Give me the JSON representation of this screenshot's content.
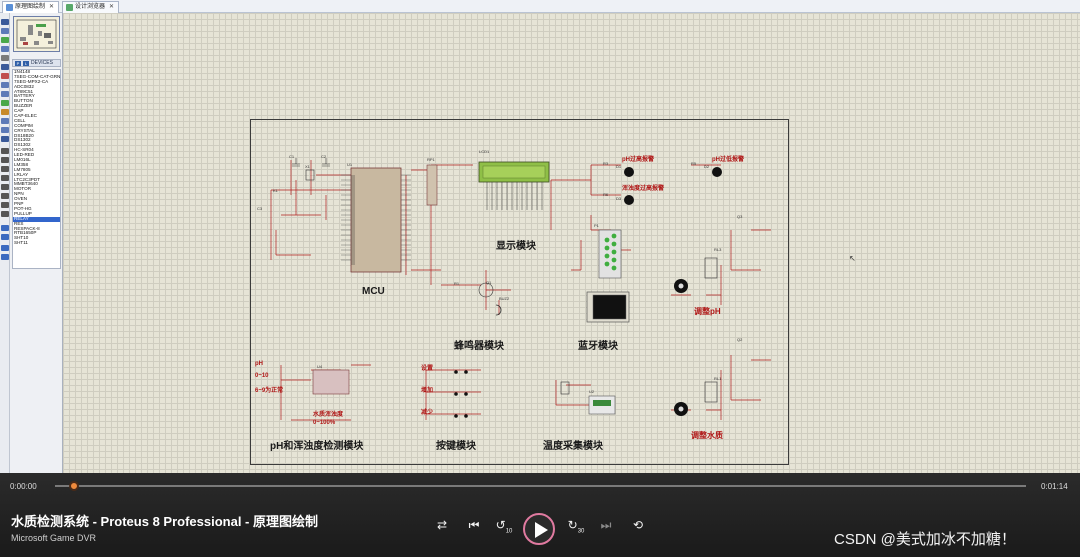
{
  "tabs": [
    {
      "label": "原理图绘制",
      "close": "✕"
    },
    {
      "label": "设计浏览器",
      "close": "✕"
    }
  ],
  "device_panel": {
    "p_button": "P",
    "l_button": "L",
    "title": "DEVICES",
    "items": [
      "1N4148",
      "7SEG-COM-CAT-GRN",
      "7SEG-MPX2-CA",
      "ADC0832",
      "AT89C51",
      "BATTERY",
      "BUTTON",
      "BUZZER",
      "CAP",
      "CAP-ELEC",
      "CELL",
      "COMPIM",
      "CRYSTAL",
      "DS18B20",
      "DS1302",
      "DS1302",
      "HC-SR04",
      "LED-RED",
      "LM016L",
      "LM358",
      "LM7805",
      "LRLAY",
      "LTC2C3PDT",
      "MMBT3640",
      "MOTOR",
      "NPN",
      "OVEN",
      "PNP",
      "POT-HG",
      "PULLUP",
      "RELAY",
      "RES",
      "RESPACK-8",
      "RTB1650P",
      "SHT10",
      "SHT11"
    ],
    "selected_index": 30
  },
  "schematic": {
    "labels": {
      "mcu": "MCU",
      "display": "显示模块",
      "buzzer": "蜂鸣器模块",
      "bluetooth": "蓝牙模块",
      "ph_turb": "pH和浑浊度检测模块",
      "keys": "按键模块",
      "temp": "温度采集模块",
      "adj_ph": "调整pH",
      "adj_water": "调整水质",
      "ph_alarm": "pH过高报警",
      "ph_low_alarm": "pH过低报警",
      "turb_alarm": "浑浊度过高报警",
      "ph_range": "0~10",
      "ph_normal": "6~9为正常",
      "ph": "pH",
      "turb_desc": "水质浑浊度",
      "turb_range": "0~100%",
      "key_set": "设置",
      "key_add": "增加",
      "key_sub": "减少",
      "lcd": "LCD1",
      "u1": "U1",
      "rp1": "RP1",
      "p1": "P1",
      "q1": "Q1",
      "buz2": "BUZ2",
      "q3": "Q3",
      "q2": "Q2",
      "rl3": "RL3",
      "rl1": "RL1",
      "u4": "U4",
      "u2": "U2",
      "x1": "X1",
      "c1": "C1",
      "c2": "C2",
      "c3": "C3",
      "k1": "K1",
      "r1": "R1",
      "r3": "R3",
      "r5": "R5",
      "r6": "R6",
      "d1": "D1",
      "d2": "D2",
      "d3": "D3"
    }
  },
  "player": {
    "current_time": "0:00:00",
    "total_time": "0:01:14",
    "progress": 0.0,
    "title": "水质检测系统 - Proteus 8 Professional - 原理图绘制",
    "source": "Microsoft Game DVR",
    "controls": [
      "shuffle-icon",
      "previous-icon",
      "rewind-10-icon",
      "play-icon",
      "forward-30-icon",
      "next-icon",
      "repeat-icon"
    ],
    "rewind_label": "10",
    "forward_label": "30"
  },
  "watermark": "CSDN @美式加冰不加糖！"
}
